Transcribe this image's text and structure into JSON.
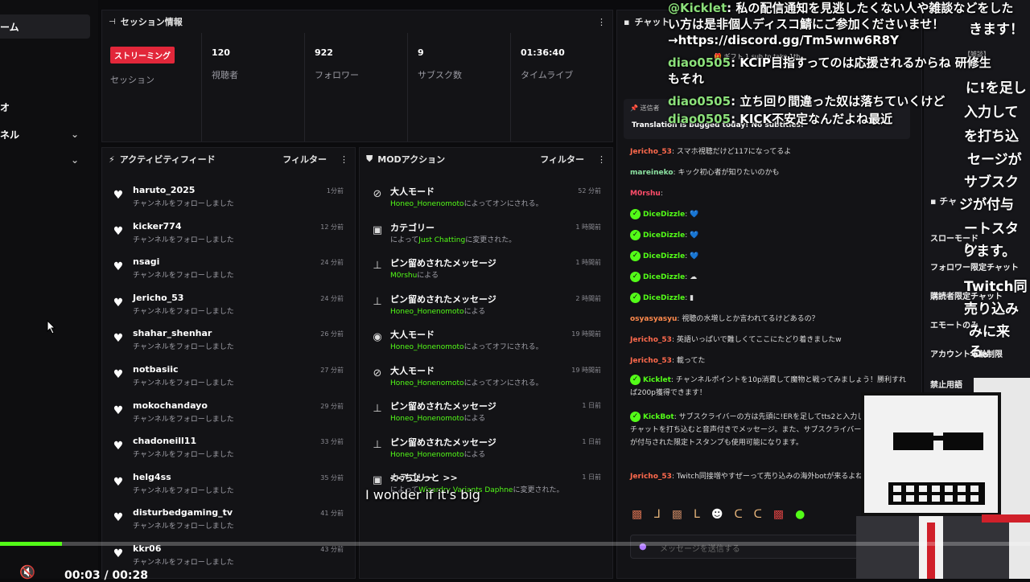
{
  "sidebar": {
    "items": [
      {
        "label": "ーム"
      },
      {
        "label": "オ"
      },
      {
        "label": "ネル"
      }
    ]
  },
  "session": {
    "title": "セッション情報",
    "live_badge": "ストリーミング",
    "session_label": "セッション",
    "stats": [
      {
        "value": "120",
        "label": "視聴者"
      },
      {
        "value": "922",
        "label": "フォロワー"
      },
      {
        "value": "9",
        "label": "サブスク数"
      },
      {
        "value": "01:36:40",
        "label": "タイムライブ"
      }
    ]
  },
  "activity": {
    "title": "アクティビティフィード",
    "filter": "フィルター",
    "rows": [
      {
        "name": "haruto_2025",
        "text": "チャンネルをフォローしました",
        "time": "1分前"
      },
      {
        "name": "kicker774",
        "text": "チャンネルをフォローしました",
        "time": "12 分前"
      },
      {
        "name": "nsagi",
        "text": "チャンネルをフォローしました",
        "time": "24 分前"
      },
      {
        "name": "Jericho_53",
        "text": "チャンネルをフォローしました",
        "time": "24 分前"
      },
      {
        "name": "shahar_shenhar",
        "text": "チャンネルをフォローしました",
        "time": "26 分前"
      },
      {
        "name": "notbasiic",
        "text": "チャンネルをフォローしました",
        "time": "27 分前"
      },
      {
        "name": "mokochandayo",
        "text": "チャンネルをフォローしました",
        "time": "29 分前"
      },
      {
        "name": "chadoneill11",
        "text": "チャンネルをフォローしました",
        "time": "33 分前"
      },
      {
        "name": "helg4ss",
        "text": "チャンネルをフォローしました",
        "time": "35 分前"
      },
      {
        "name": "disturbedgaming_tv",
        "text": "チャンネルをフォローしました",
        "time": "41 分前"
      },
      {
        "name": "kkr06",
        "text": "チャンネルをフォローしました",
        "time": "43 分前"
      }
    ]
  },
  "mod": {
    "title": "MODアクション",
    "filter": "フィルター",
    "rows": [
      {
        "icon": "⊘",
        "name": "大人モード",
        "user": "Honeo_Honenomoto",
        "text": "によってオンにされる。",
        "time": "52 分前"
      },
      {
        "icon": "▣",
        "name": "カテゴリー",
        "user": "Just Chatting",
        "text": "によって",
        "text2": "に変更された。",
        "time": "1 時間前"
      },
      {
        "icon": "⊥",
        "name": "ピン留めされたメッセージ",
        "user": "M0rshu",
        "text": "による",
        "time": "1 時間前"
      },
      {
        "icon": "⊥",
        "name": "ピン留めされたメッセージ",
        "user": "Honeo_Honenomoto",
        "text": "による",
        "time": "2 時間前"
      },
      {
        "icon": "◉",
        "name": "大人モード",
        "user": "Honeo_Honenomoto",
        "text": "によってオフにされる。",
        "time": "19 時間前"
      },
      {
        "icon": "⊘",
        "name": "大人モード",
        "user": "Honeo_Honenomoto",
        "text": "によってオンにされる。",
        "time": "19 時間前"
      },
      {
        "icon": "⊥",
        "name": "ピン留めされたメッセージ",
        "user": "Honeo_Honenomoto",
        "text": "による",
        "time": "1 日前"
      },
      {
        "icon": "⊥",
        "name": "ピン留めされたメッセージ",
        "user": "Honeo_Honenomoto",
        "text": "による",
        "time": "1 日前"
      },
      {
        "icon": "▣",
        "name": "カテゴリー",
        "user": "Wizardry Variants Daphne",
        "text": "によって",
        "text2": "に変更された。",
        "time": "1 日前"
      }
    ]
  },
  "chat": {
    "title": "チャット",
    "pinned_label": "送信者",
    "pinned_text": "Translation is bugged today! No subtitles!",
    "gift_text": "ギフト 1 sub to take 1th",
    "lines": [
      {
        "user": "Jericho_53",
        "color": "#ff6a4d",
        "text": "スマホ視聴だけど117になってるよ"
      },
      {
        "user": "mareineko",
        "color": "#8be0a0",
        "text": "キック初心者が知りたいのかも"
      },
      {
        "user": "M0rshu",
        "color": "#ff4d6a",
        "text": ""
      },
      {
        "user": "DiceDizzle",
        "color": "#53fc18",
        "text": "💙"
      },
      {
        "user": "DiceDizzle",
        "color": "#53fc18",
        "text": "💙"
      },
      {
        "user": "DiceDizzle",
        "color": "#53fc18",
        "text": "💙"
      },
      {
        "user": "DiceDizzle",
        "color": "#53fc18",
        "text": "☁"
      },
      {
        "user": "DiceDizzle",
        "color": "#53fc18",
        "text": "▮"
      },
      {
        "user": "osyasyasyu",
        "color": "#ff8a4d",
        "text": "視聴の水増しとか言われてるけどあるの？"
      },
      {
        "user": "Jericho_53",
        "color": "#ff6a4d",
        "text": "英語いっぱいで難しくてここにたどり着きましたw"
      },
      {
        "user": "Jericho_53",
        "color": "#ff6a4d",
        "text": "載ってた"
      },
      {
        "user": "Kicklet",
        "color": "#53fc18",
        "text": "チャンネルポイントを10p消費して魔物と戦ってみましょう！勝利すれば200p獲得できます！"
      },
      {
        "user": "KickBot",
        "color": "#53fc18",
        "text": "サブスクライバーの方は先頭に!ERを足してtts2と入力してから任意のチャットを打ち込むと音声付きでメッセージ。また、サブスクライバー限定のバッジが付与された限定トスタンプも使用可能になります。"
      },
      {
        "user": "Jericho_53",
        "color": "#ff6a4d",
        "text": "Twitch同接増やすぜーって売り込みの海外botが来るよね"
      }
    ],
    "input_placeholder": "メッセージを送信する"
  },
  "overlay": {
    "lines": [
      {
        "user": "@Kicklet",
        "text": "私の配信通知を見逃したくない人や雑談などをしたい方は是非個人ディスコ鯖にご参加くださいませ！→https://discord.gg/Tm5wnw6R8Y"
      },
      {
        "user": "diao0505",
        "text": "KCIP目指すってのは応援されるからね 研修生もそれ"
      },
      {
        "user": "diao0505",
        "text": "立ち回り間違った奴は落ちていくけど"
      },
      {
        "user": "diao0505",
        "text": "KICK不安定なんだよね最近"
      }
    ],
    "subtitle_jp": "<<ちょっと >>",
    "subtitle_en": "I wonder if it's big"
  },
  "right_panel": {
    "top_text": "きます！",
    "tag": "【雑談】",
    "items": [
      "スローモード",
      "フォロワー限定チャット",
      "購読者限定チャット",
      "エモートのみ",
      "アカウント年齢制限",
      "禁止用語"
    ],
    "title": "チャ",
    "big_lines": [
      "に!を足し",
      "入力して",
      "を打ち込",
      "セージが",
      "サブスク",
      "ジが付与",
      "ートスタン",
      "ります。",
      "Twitch同",
      "売り込み",
      "みに来る。"
    ]
  },
  "player": {
    "time": "00:03 / 00:28",
    "progress": 0.06
  }
}
